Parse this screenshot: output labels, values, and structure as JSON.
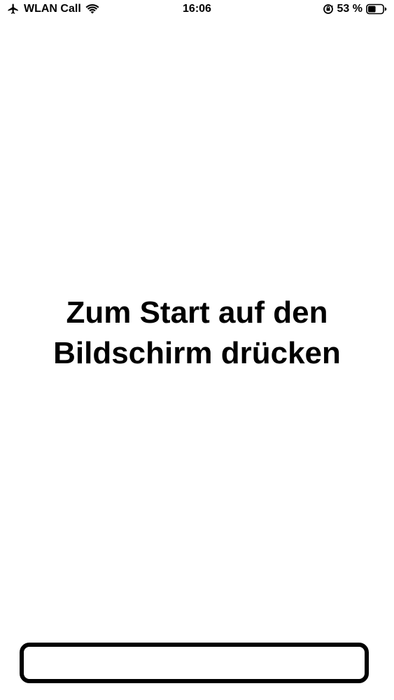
{
  "status_bar": {
    "carrier": "WLAN Call",
    "time": "16:06",
    "battery_percent": "53 %",
    "battery_level": 0.53,
    "icons": {
      "airplane": "airplane-icon",
      "wifi": "wifi-icon",
      "rotation_lock": "rotation-lock-icon",
      "battery": "battery-icon"
    }
  },
  "main": {
    "headline_line1": "Zum Start auf den",
    "headline_line2": "Bildschirm drücken"
  },
  "colors": {
    "background": "#ffffff",
    "text": "#000000"
  }
}
